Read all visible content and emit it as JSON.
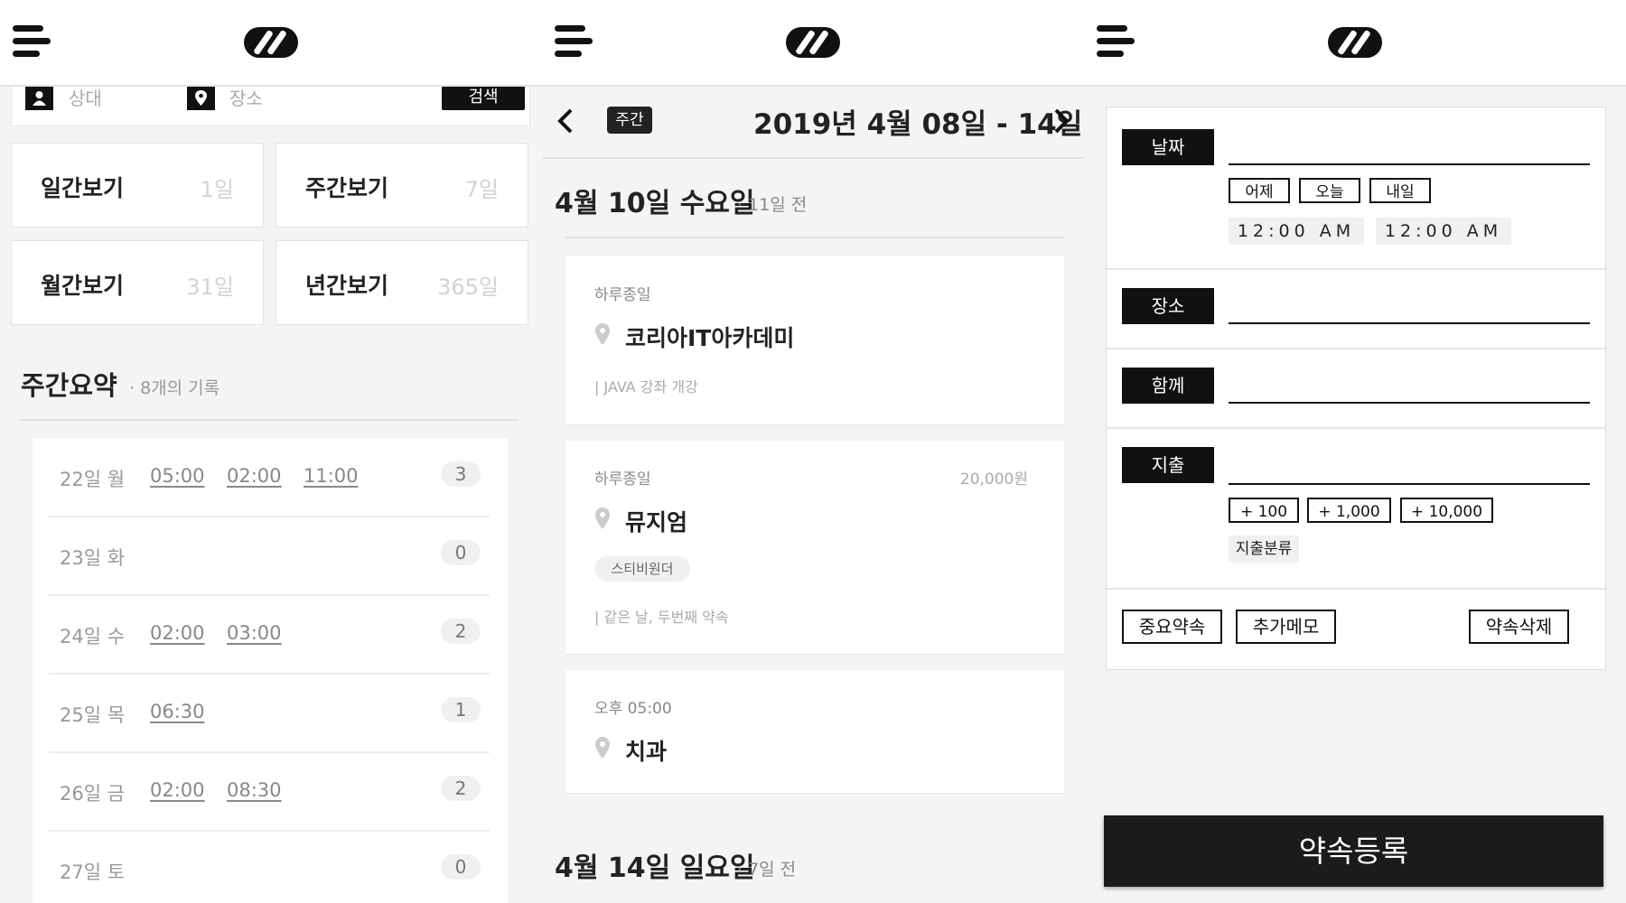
{
  "panel1": {
    "search": {
      "partner_placeholder": "상대",
      "place_placeholder": "장소",
      "button": "검색"
    },
    "views": [
      {
        "label": "일간보기",
        "count": "1일"
      },
      {
        "label": "주간보기",
        "count": "7일"
      },
      {
        "label": "월간보기",
        "count": "31일"
      },
      {
        "label": "년간보기",
        "count": "365일"
      }
    ],
    "summary_title": "주간요약",
    "summary_sub": "· 8개의 기록",
    "rows": [
      {
        "day": "22일 월",
        "times": [
          "05:00",
          "02:00",
          "11:00"
        ],
        "count": "3"
      },
      {
        "day": "23일 화",
        "times": [],
        "count": "0"
      },
      {
        "day": "24일 수",
        "times": [
          "02:00",
          "03:00"
        ],
        "count": "2"
      },
      {
        "day": "25일 목",
        "times": [
          "06:30"
        ],
        "count": "1"
      },
      {
        "day": "26일 금",
        "times": [
          "02:00",
          "08:30"
        ],
        "count": "2"
      },
      {
        "day": "27일 토",
        "times": [],
        "count": "0"
      }
    ]
  },
  "panel2": {
    "week_badge": "주간",
    "week_range": "2019년 4월 08일 - 14일",
    "day1_title": "4월 10일 수요일",
    "day1_sub": "· 11일 전",
    "events": [
      {
        "time": "하루종일",
        "price": "",
        "name": "코리아IT아카데미",
        "tag": "",
        "memo": "| JAVA 강좌 개강"
      },
      {
        "time": "하루종일",
        "price": "20,000원",
        "name": "뮤지엄",
        "tag": "스티비원더",
        "memo": "| 같은 날, 두번째 약속"
      },
      {
        "time": "오후 05:00",
        "price": "",
        "name": "치과",
        "tag": "",
        "memo": ""
      }
    ],
    "day2_title": "4월 14일 일요일",
    "day2_sub": "· 7일 전"
  },
  "panel3": {
    "date_label": "날짜",
    "quick_days": [
      "어제",
      "오늘",
      "내일"
    ],
    "start_time": "12:00 AM",
    "end_time": "12:00 AM",
    "place_label": "장소",
    "with_label": "함께",
    "expense_label": "지출",
    "amounts": [
      "+ 100",
      "+ 1,000",
      "+ 10,000"
    ],
    "expense_category": "지출분류",
    "important": "중요약속",
    "memo": "추가메모",
    "delete": "약속삭제",
    "submit": "약속등록"
  },
  "colors": {
    "accent": "#111111",
    "background": "#f4f4f4"
  },
  "icons": [
    "menu-icon",
    "logo-icon",
    "person-icon",
    "location-icon",
    "chevron-left-icon",
    "chevron-right-icon",
    "pin-icon"
  ]
}
